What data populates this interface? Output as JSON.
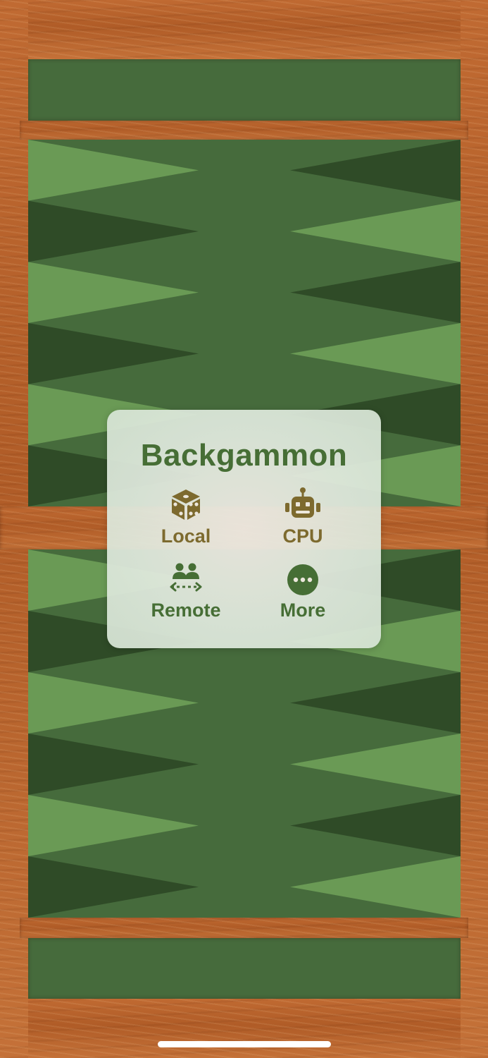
{
  "game": {
    "title": "Backgammon"
  },
  "menu": {
    "options": [
      {
        "label": "Local",
        "icon": "dice-icon",
        "color": "#7d6a2e"
      },
      {
        "label": "CPU",
        "icon": "robot-icon",
        "color": "#7d6a2e"
      },
      {
        "label": "Remote",
        "icon": "people-exchange-icon",
        "color": "#466e35"
      },
      {
        "label": "More",
        "icon": "ellipsis-circle-icon",
        "color": "#466e35"
      }
    ]
  },
  "colors": {
    "wood": "#b9652e",
    "felt": "#466b3c",
    "point_light": "#6a9a55",
    "point_dark": "#2f4b27",
    "title": "#466e35"
  }
}
